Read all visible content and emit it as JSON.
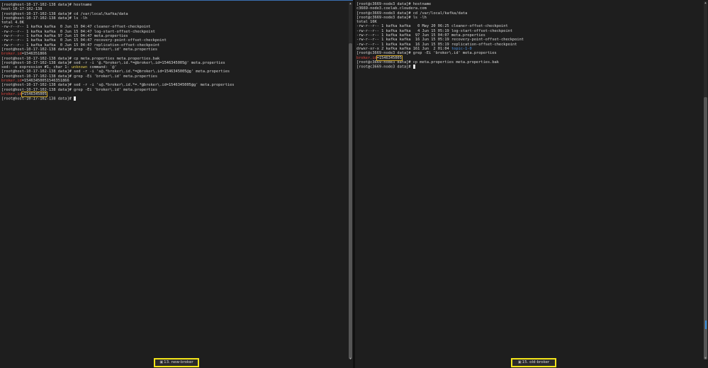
{
  "left": {
    "tab": {
      "icon": "terminal-icon",
      "label": "13. new-broker"
    },
    "lines": [
      [
        {
          "t": "[root@host-10-17-102-138 data]# hostname"
        }
      ],
      [
        {
          "t": "host-10-17-102-138"
        }
      ],
      [
        {
          "t": "[root@host-10-17-102-138 data]# cd /var/local/kafka/data"
        }
      ],
      [
        {
          "t": "[root@host-10-17-102-138 data]# ls -lh"
        }
      ],
      [
        {
          "t": "total 4.0K"
        }
      ],
      [
        {
          "t": "-rw-r--r-- 1 kafka kafka  0 Jun 15 04:47 cleaner-offset-checkpoint"
        }
      ],
      [
        {
          "t": "-rw-r--r-- 1 kafka kafka  0 Jun 15 04:47 log-start-offset-checkpoint"
        }
      ],
      [
        {
          "t": "-rw-r--r-- 1 kafka kafka 97 Jun 15 04:47 meta.properties"
        }
      ],
      [
        {
          "t": "-rw-r--r-- 1 kafka kafka  0 Jun 15 04:47 recovery-point-offset-checkpoint"
        }
      ],
      [
        {
          "t": "-rw-r--r-- 1 kafka kafka  0 Jun 15 04:47 replication-offset-checkpoint"
        }
      ],
      [
        {
          "t": "[root@host-10-17-102-138 data]# grep -Ei 'broker\\.id' meta.properties"
        }
      ],
      [
        {
          "t": "broker.id",
          "c": "hl-red"
        },
        {
          "t": "=1546351866"
        }
      ],
      [
        {
          "t": "[root@host-10-17-102-138 data]# cp meta.properties meta.properties.bak"
        }
      ],
      [
        {
          "t": "[root@host-10-17-102-138 data]# sed -r -i '@.*broker\\.id.*=@broker\\.id=1546345005@' meta.properties"
        }
      ],
      [
        {
          "t": "sed: -e expression #1, char 1: "
        },
        {
          "t": "unknown",
          "c": "hl-yellow"
        },
        {
          "t": " command: `@'"
        }
      ],
      [
        {
          "t": "[root@host-10-17-102-138 data]# sed -r -i 's@.*broker\\.id.*=@broker\\.id=1546345005@g' meta.properties"
        }
      ],
      [
        {
          "t": "[root@host-10-17-102-138 data]# grep -Ei 'broker\\.id' meta.properties"
        }
      ],
      [
        {
          "t": "broker.id",
          "c": "hl-red"
        },
        {
          "t": "=15463450051546351866"
        }
      ],
      [
        {
          "t": "[root@host-10-17-102-138 data]# sed -r -i 's@.*broker\\.id.*=.*@broker\\.id=1546345005@g' meta.properties"
        }
      ],
      [
        {
          "t": "[root@host-10-17-102-138 data]# grep -Ei 'broker\\.id' meta.properties"
        }
      ],
      [
        {
          "t": "broker.id",
          "c": "hl-red"
        },
        {
          "t": "=1546345005",
          "box": true
        }
      ],
      [
        {
          "t": "[root@host-10-17-102-138 data]# "
        },
        {
          "cursor": true
        }
      ]
    ]
  },
  "right": {
    "tab": {
      "icon": "terminal-icon",
      "label": "15. old-broker"
    },
    "lines": [
      [
        {
          "t": "[root@c3669-node3 data]# hostname"
        }
      ],
      [
        {
          "t": "c3669-node3.coelab.cloudera.com"
        }
      ],
      [
        {
          "t": "[root@c3669-node3 data]# cd /var/local/kafka/data"
        }
      ],
      [
        {
          "t": "[root@c3669-node3 data]# ls -lh"
        }
      ],
      [
        {
          "t": "total 16K"
        }
      ],
      [
        {
          "t": "-rw-r--r-- 1 kafka kafka   0 May 20 06:25 cleaner-offset-checkpoint"
        }
      ],
      [
        {
          "t": "-rw-r--r-- 1 kafka kafka   4 Jun 15 05:19 log-start-offset-checkpoint"
        }
      ],
      [
        {
          "t": "-rw-r--r-- 1 kafka kafka  97 Jun 15 04:07 meta.properties"
        }
      ],
      [
        {
          "t": "-rw-r--r-- 1 kafka kafka  16 Jun 15 05:19 recovery-point-offset-checkpoint"
        }
      ],
      [
        {
          "t": "-rw-r--r-- 1 kafka kafka  16 Jun 15 05:19 replication-offset-checkpoint"
        }
      ],
      [
        {
          "t": "drwxr-xr-x 2 kafka kafka 161 Jun  2 01:04 "
        },
        {
          "t": "topic-1-0",
          "c": "hl-blue"
        }
      ],
      [
        {
          "t": "[root@c3669-node3 data]# grep -Ei 'broker\\.id' meta.properties"
        }
      ],
      [
        {
          "t": "broker.id",
          "c": "hl-red"
        },
        {
          "t": "=1546345005",
          "box": true
        }
      ],
      [
        {
          "t": "[root@c3669-node3 data]# cp meta.properties meta.properties.bak"
        }
      ],
      [
        {
          "t": "[root@c3669-node3 data]# "
        },
        {
          "cursor": true
        }
      ]
    ]
  },
  "colors": {
    "background": "#1e1e1e",
    "text": "#d8d8d8",
    "keyword_red": "#e0443c",
    "tab_border": "#f2e41a"
  }
}
